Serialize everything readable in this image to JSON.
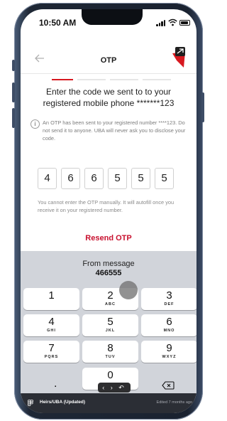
{
  "status_bar": {
    "time": "10:50 AM"
  },
  "nav": {
    "title": "OTP",
    "back_icon": "arrow-left-icon",
    "logo_icon": "uba-logo-icon"
  },
  "progress": {
    "step": 1,
    "of": 4,
    "active_color": "#d71920",
    "inactive_color": "#e6e6e6"
  },
  "heading": "Enter the code we sent to to your registered mobile phone *******123",
  "info": {
    "icon": "info-icon",
    "text": "An OTP has been sent to your registered number ****123. Do not send it to anyone. UBA will never ask you to disclose your code."
  },
  "otp": {
    "digits": [
      "4",
      "6",
      "6",
      "5",
      "5",
      "5"
    ]
  },
  "otp_note": "You cannot enter the OTP manually. It will autofill once you receive it on your registered number.",
  "resend_label": "Resend OTP",
  "keyboard": {
    "suggestion_label": "From message",
    "suggestion_code": "466555",
    "keys": [
      {
        "digit": "1",
        "letters": ""
      },
      {
        "digit": "2",
        "letters": "ABC"
      },
      {
        "digit": "3",
        "letters": "DEF"
      },
      {
        "digit": "4",
        "letters": "GHI"
      },
      {
        "digit": "5",
        "letters": "JKL"
      },
      {
        "digit": "6",
        "letters": "MNO"
      },
      {
        "digit": "7",
        "letters": "PQRS"
      },
      {
        "digit": "8",
        "letters": "TUV"
      },
      {
        "digit": "9",
        "letters": "WXYZ"
      },
      {
        "digit": "0",
        "letters": ""
      }
    ],
    "dot_label": ".",
    "delete_icon": "backspace-icon",
    "cursor_control": "‹ › ↶"
  },
  "bottom_bar": {
    "icon": "figma-icon",
    "title": "Heirs/UBA (Updated)",
    "edited": "Edited 7 months ago"
  },
  "colors": {
    "accent": "#c8102e",
    "keyboard_bg": "#d1d4da",
    "bottom_bar_bg": "#2b2e35"
  }
}
